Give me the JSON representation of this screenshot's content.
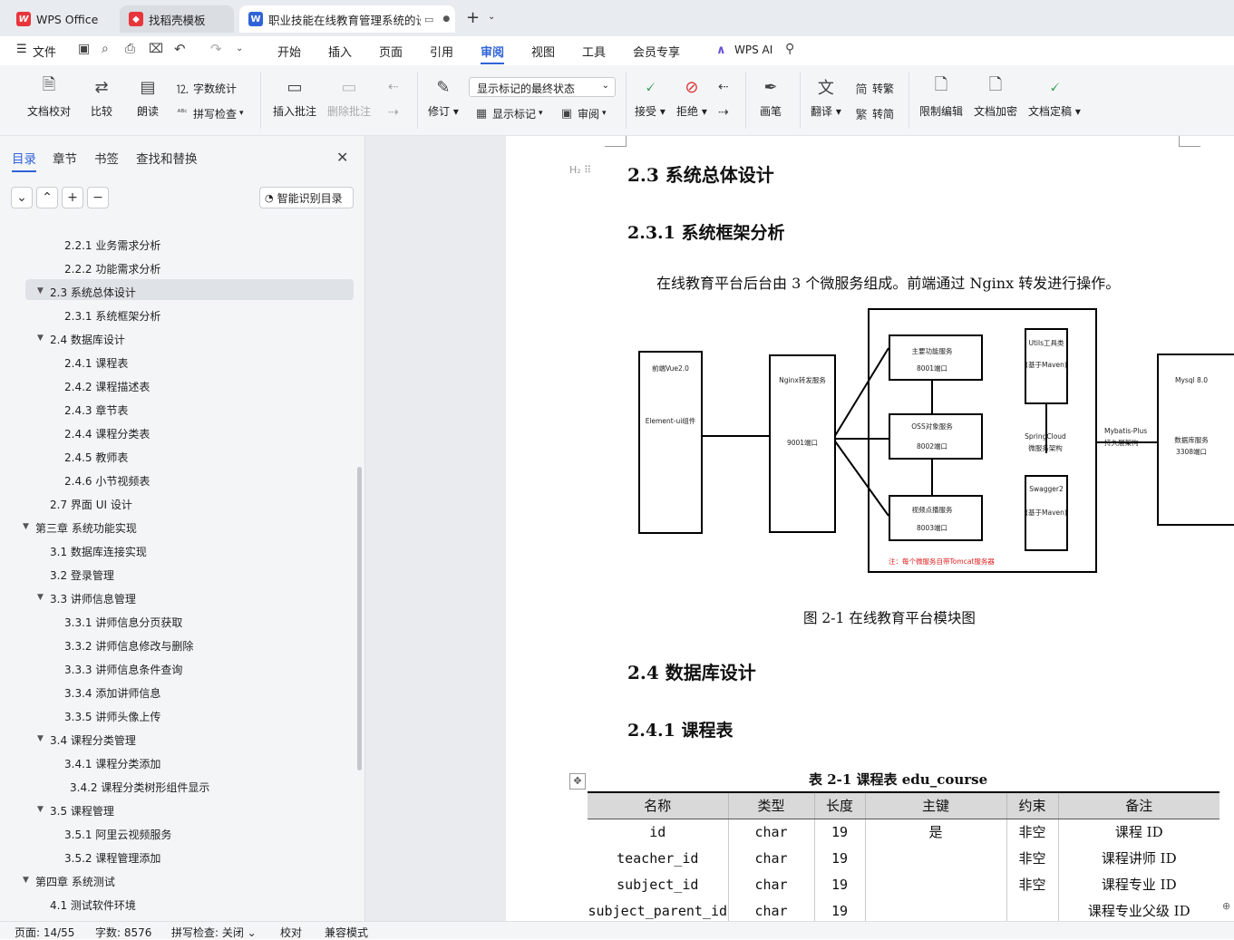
{
  "tabs": [
    {
      "label": "WPS Office",
      "icon": "wps-logo"
    },
    {
      "label": "找稻壳模板",
      "icon": "daoke-icon"
    },
    {
      "label": "职业技能在线教育管理系统的设",
      "icon": "word-doc-icon"
    }
  ],
  "menu": {
    "file": "文件",
    "items": [
      "开始",
      "插入",
      "页面",
      "引用",
      "审阅",
      "视图",
      "工具",
      "会员专享"
    ],
    "active": "审阅",
    "wps_ai": "WPS AI"
  },
  "ribbon": {
    "doc_proof": "文档校对",
    "compare": "比较",
    "read_aloud": "朗读",
    "word_count": "字数统计",
    "spell_check": "拼写检查",
    "insert_comment": "插入批注",
    "delete_comment": "删除批注",
    "track": "修订",
    "markup_state": "显示标记的最终状态",
    "show_markup": "显示标记",
    "review": "审阅",
    "accept": "接受",
    "reject": "拒绝",
    "pen": "画笔",
    "translate": "翻译",
    "to_traditional": "转繁",
    "to_simplified": "转简",
    "restrict_edit": "限制编辑",
    "encrypt": "文档加密",
    "finalize": "文档定稿"
  },
  "sidebar": {
    "tabs": [
      "目录",
      "章节",
      "书签",
      "查找和替换"
    ],
    "active": "目录",
    "smart_toc": "智能识别目录",
    "toc": [
      {
        "label": "2.2.1  业务需求分析",
        "level": 3
      },
      {
        "label": "2.2.2  功能需求分析",
        "level": 3
      },
      {
        "label": "2.3 系统总体设计",
        "level": 2,
        "expanded": true,
        "selected": true
      },
      {
        "label": "2.3.1  系统框架分析",
        "level": 3
      },
      {
        "label": "2.4 数据库设计",
        "level": 2,
        "expanded": true
      },
      {
        "label": "2.4.1 课程表",
        "level": 3
      },
      {
        "label": "2.4.2 课程描述表",
        "level": 3
      },
      {
        "label": "2.4.3  章节表",
        "level": 3
      },
      {
        "label": "2.4.4  课程分类表",
        "level": 3
      },
      {
        "label": "2.4.5  教师表",
        "level": 3
      },
      {
        "label": "2.4.6  小节视频表",
        "level": 3
      },
      {
        "label": "2.7 界面 UI 设计",
        "level": 2
      },
      {
        "label": "第三章  系统功能实现",
        "level": 1,
        "expanded": true
      },
      {
        "label": "3.1 数据库连接实现",
        "level": 2
      },
      {
        "label": "3.2 登录管理",
        "level": 2
      },
      {
        "label": "3.3 讲师信息管理",
        "level": 2,
        "expanded": true
      },
      {
        "label": "3.3.1 讲师信息分页获取",
        "level": 3
      },
      {
        "label": "3.3.2 讲师信息修改与删除",
        "level": 3
      },
      {
        "label": "3.3.3 讲师信息条件查询",
        "level": 3
      },
      {
        "label": "3.3.4 添加讲师信息",
        "level": 3
      },
      {
        "label": "3.3.5 讲师头像上传",
        "level": 3
      },
      {
        "label": "3.4 课程分类管理",
        "level": 2,
        "expanded": true
      },
      {
        "label": "3.4.1 课程分类添加",
        "level": 3
      },
      {
        "label": "3.4.2 课程分类树形组件显示",
        "level": 3
      },
      {
        "label": "3.5 课程管理",
        "level": 2,
        "expanded": true
      },
      {
        "label": "3.5.1 阿里云视频服务",
        "level": 3
      },
      {
        "label": "3.5.2  课程管理添加",
        "level": 3
      },
      {
        "label": "第四章  系统测试",
        "level": 1,
        "expanded": true
      },
      {
        "label": "4.1 测试软件环境",
        "level": 2
      }
    ]
  },
  "document": {
    "h_2_3": "2.3  系统总体设计",
    "h_2_3_1": "2.3.1  系统框架分析",
    "para": "在线教育平台后台由 3 个微服务组成。前端通过 Nginx 转发进行操作。",
    "diagram": {
      "frontend": [
        "前端Vue2.0",
        "Element-ui组件"
      ],
      "nginx": [
        "Nginx转发服务",
        "9001端口"
      ],
      "main_service": [
        "主要功能服务",
        "8001端口"
      ],
      "oss_service": [
        "OSS对象服务",
        "8002端口"
      ],
      "video_service": [
        "视频点播服务",
        "8003端口"
      ],
      "utils": [
        "Utils工具类",
        "(基于Maven)"
      ],
      "springcloud": [
        "SpringCloud",
        "微服务架构"
      ],
      "swagger": [
        "Swagger2",
        "(基于Maven)"
      ],
      "note": "注：每个微服务自带Tomcat服务器",
      "mybatis": [
        "Mybatis-Plus",
        "持久层架构"
      ],
      "mysql": [
        "Mysql 8.0",
        "数据库服务",
        "3308端口"
      ]
    },
    "figure_caption": "图 2-1  在线教育平台模块图",
    "h_2_4": "2.4 数据库设计",
    "h_2_4_1": "2.4.1 课程表",
    "table_caption": "表 2-1  课程表 edu_course",
    "table": {
      "headers": [
        "名称",
        "类型",
        "长度",
        "主键",
        "约束",
        "备注"
      ],
      "rows": [
        [
          "id",
          "char",
          "19",
          "是",
          "非空",
          "课程 ID"
        ],
        [
          "teacher_id",
          "char",
          "19",
          "",
          "非空",
          "课程讲师 ID"
        ],
        [
          "subject_id",
          "char",
          "19",
          "",
          "非空",
          "课程专业 ID"
        ],
        [
          "subject_parent_id",
          "char",
          "19",
          "",
          "",
          "课程专业父级 ID"
        ]
      ]
    }
  },
  "status": {
    "page": "页面: 14/55",
    "words": "字数: 8576",
    "spell": "拼写检查: 关闭",
    "proof": "校对",
    "compat": "兼容模式"
  },
  "colors": {
    "accent": "#2f63d8",
    "selected_bg": "#dfe2e7"
  }
}
